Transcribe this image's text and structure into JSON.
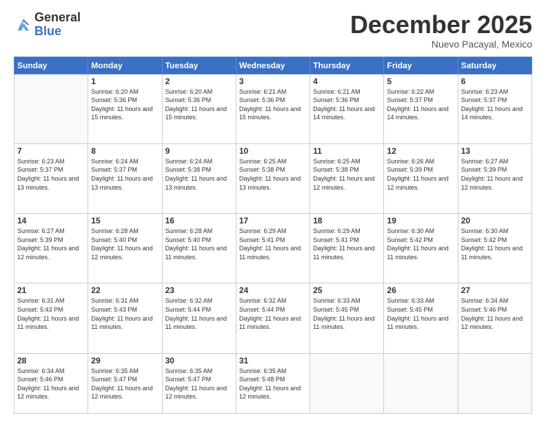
{
  "logo": {
    "general": "General",
    "blue": "Blue"
  },
  "header": {
    "month": "December 2025",
    "location": "Nuevo Pacayal, Mexico"
  },
  "weekdays": [
    "Sunday",
    "Monday",
    "Tuesday",
    "Wednesday",
    "Thursday",
    "Friday",
    "Saturday"
  ],
  "weeks": [
    [
      {
        "day": null
      },
      {
        "day": "1",
        "sunrise": "6:20 AM",
        "sunset": "5:36 PM",
        "daylight": "11 hours and 15 minutes."
      },
      {
        "day": "2",
        "sunrise": "6:20 AM",
        "sunset": "5:36 PM",
        "daylight": "11 hours and 15 minutes."
      },
      {
        "day": "3",
        "sunrise": "6:21 AM",
        "sunset": "5:36 PM",
        "daylight": "11 hours and 15 minutes."
      },
      {
        "day": "4",
        "sunrise": "6:21 AM",
        "sunset": "5:36 PM",
        "daylight": "11 hours and 14 minutes."
      },
      {
        "day": "5",
        "sunrise": "6:22 AM",
        "sunset": "5:37 PM",
        "daylight": "11 hours and 14 minutes."
      },
      {
        "day": "6",
        "sunrise": "6:23 AM",
        "sunset": "5:37 PM",
        "daylight": "11 hours and 14 minutes."
      }
    ],
    [
      {
        "day": "7",
        "sunrise": "6:23 AM",
        "sunset": "5:37 PM",
        "daylight": "11 hours and 13 minutes."
      },
      {
        "day": "8",
        "sunrise": "6:24 AM",
        "sunset": "5:37 PM",
        "daylight": "11 hours and 13 minutes."
      },
      {
        "day": "9",
        "sunrise": "6:24 AM",
        "sunset": "5:38 PM",
        "daylight": "11 hours and 13 minutes."
      },
      {
        "day": "10",
        "sunrise": "6:25 AM",
        "sunset": "5:38 PM",
        "daylight": "11 hours and 13 minutes."
      },
      {
        "day": "11",
        "sunrise": "6:25 AM",
        "sunset": "5:38 PM",
        "daylight": "11 hours and 12 minutes."
      },
      {
        "day": "12",
        "sunrise": "6:26 AM",
        "sunset": "5:39 PM",
        "daylight": "11 hours and 12 minutes."
      },
      {
        "day": "13",
        "sunrise": "6:27 AM",
        "sunset": "5:39 PM",
        "daylight": "11 hours and 12 minutes."
      }
    ],
    [
      {
        "day": "14",
        "sunrise": "6:27 AM",
        "sunset": "5:39 PM",
        "daylight": "11 hours and 12 minutes."
      },
      {
        "day": "15",
        "sunrise": "6:28 AM",
        "sunset": "5:40 PM",
        "daylight": "11 hours and 12 minutes."
      },
      {
        "day": "16",
        "sunrise": "6:28 AM",
        "sunset": "5:40 PM",
        "daylight": "11 hours and 11 minutes."
      },
      {
        "day": "17",
        "sunrise": "6:29 AM",
        "sunset": "5:41 PM",
        "daylight": "11 hours and 11 minutes."
      },
      {
        "day": "18",
        "sunrise": "6:29 AM",
        "sunset": "5:41 PM",
        "daylight": "11 hours and 11 minutes."
      },
      {
        "day": "19",
        "sunrise": "6:30 AM",
        "sunset": "5:42 PM",
        "daylight": "11 hours and 11 minutes."
      },
      {
        "day": "20",
        "sunrise": "6:30 AM",
        "sunset": "5:42 PM",
        "daylight": "11 hours and 11 minutes."
      }
    ],
    [
      {
        "day": "21",
        "sunrise": "6:31 AM",
        "sunset": "5:43 PM",
        "daylight": "11 hours and 11 minutes."
      },
      {
        "day": "22",
        "sunrise": "6:31 AM",
        "sunset": "5:43 PM",
        "daylight": "11 hours and 11 minutes."
      },
      {
        "day": "23",
        "sunrise": "6:32 AM",
        "sunset": "5:44 PM",
        "daylight": "11 hours and 11 minutes."
      },
      {
        "day": "24",
        "sunrise": "6:32 AM",
        "sunset": "5:44 PM",
        "daylight": "11 hours and 11 minutes."
      },
      {
        "day": "25",
        "sunrise": "6:33 AM",
        "sunset": "5:45 PM",
        "daylight": "11 hours and 11 minutes."
      },
      {
        "day": "26",
        "sunrise": "6:33 AM",
        "sunset": "5:45 PM",
        "daylight": "11 hours and 11 minutes."
      },
      {
        "day": "27",
        "sunrise": "6:34 AM",
        "sunset": "5:46 PM",
        "daylight": "11 hours and 12 minutes."
      }
    ],
    [
      {
        "day": "28",
        "sunrise": "6:34 AM",
        "sunset": "5:46 PM",
        "daylight": "11 hours and 12 minutes."
      },
      {
        "day": "29",
        "sunrise": "6:35 AM",
        "sunset": "5:47 PM",
        "daylight": "11 hours and 12 minutes."
      },
      {
        "day": "30",
        "sunrise": "6:35 AM",
        "sunset": "5:47 PM",
        "daylight": "11 hours and 12 minutes."
      },
      {
        "day": "31",
        "sunrise": "6:35 AM",
        "sunset": "5:48 PM",
        "daylight": "11 hours and 12 minutes."
      },
      {
        "day": null
      },
      {
        "day": null
      },
      {
        "day": null
      }
    ]
  ]
}
